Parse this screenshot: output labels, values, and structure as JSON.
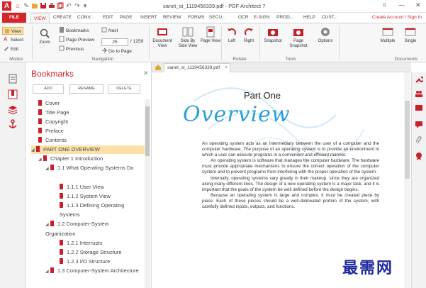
{
  "titlebar": {
    "app_logo": "A",
    "title": "sanet_st_1119456339.pdf - PDF Architect 7",
    "quick_access": [
      "home-icon",
      "pin-icon",
      "folder-icon",
      "save-icon",
      "print-icon",
      "copy-icon",
      "undo-icon",
      "redo-icon",
      "dropdown-icon"
    ],
    "window_controls": [
      "restore-icon",
      "minimize-icon",
      "close-icon"
    ]
  },
  "tabs": {
    "file": "FILE",
    "items": [
      "VIEW",
      "CREATE",
      "CONV...",
      "EDIT",
      "PAGE",
      "INSERT",
      "REVIEW",
      "FORMS",
      "SECU...",
      "OCR",
      "E-SIGN",
      "PROD...",
      "HELP",
      "CUST..."
    ],
    "active": "VIEW",
    "account_link": "Create Account / Sign In"
  },
  "ribbon": {
    "modes": {
      "view": "View",
      "select": "Select",
      "edit": "Edit",
      "group": "Modes"
    },
    "zoom": "Zoom",
    "navigation": {
      "bookmarks": "Bookmarks",
      "page_preview": "Page Preview",
      "previous": "Previous",
      "next": "Next",
      "current_page": "25",
      "total_pages": "/ 1259",
      "go_to_page": "Go to Page",
      "group": "Navigation"
    },
    "document_view": "Document View",
    "side_by_side": "Side By Side View",
    "page_view": "Page View",
    "left": "Left",
    "right": "Right",
    "rotate_group": "Rotate",
    "snapshot": "Snapshot",
    "page_snapshot": "Page Snapshot",
    "tools_group": "Tools",
    "options": "Options",
    "multiple": "Multiple",
    "single": "Single",
    "documents_group": "Documents"
  },
  "bookmarks": {
    "title": "Bookmarks",
    "add": "ADD",
    "rename": "RENAME",
    "delete": "DELETE",
    "items": [
      {
        "label": "Cover"
      },
      {
        "label": "Title Page"
      },
      {
        "label": "Copyright"
      },
      {
        "label": "Preface"
      },
      {
        "label": "Contents"
      },
      {
        "label": "PART ONE OVERVIEW"
      },
      {
        "label": "Chapter 1 Introduction"
      },
      {
        "label": "1.1 What Operating Systems Do"
      },
      {
        "label": "1.1.1 User View"
      },
      {
        "label": "1.1.2 System View"
      },
      {
        "label": "1.1.3 Defining Operating Systems"
      },
      {
        "label": "1.2 Computer-System Organization"
      },
      {
        "label": "1.2.1 Interrupts"
      },
      {
        "label": "1.2.2 Storage Structure"
      },
      {
        "label": "1.2.3 I/O Structure"
      },
      {
        "label": "1.3 Computer-System Architecture"
      }
    ],
    "selected": "PART ONE OVERVIEW"
  },
  "document": {
    "tab_name": "sanet_st_1119456339.pdf",
    "part_heading": "Part One",
    "section_heading": "Overview",
    "paragraphs": [
      "An operating system acts as an intermediary between the user of a computer and the computer hardware. The purpose of an operating system is to provide an environment in which a user can execute programs in a convenient and efficient manner.",
      "An operating system is software that manages the computer hardware. The hardware must provide appropriate mechanisms to ensure the correct operation of the computer system and to prevent programs from interfering with the proper operation of the system.",
      "Internally, operating systems vary greatly in their makeup, since they are organized along many different lines. The design of a new operating system is a major task, and it is important that the goals of the system be well defined before the design begins.",
      "Because an operating system is large and complex, it must be created piece by piece. Each of these pieces should be a well-delineated portion of the system, with carefully defined inputs, outputs, and functions."
    ]
  },
  "watermark": "最需网",
  "colors": {
    "accent": "#d5262a",
    "heading_blue": "#2a9fd8",
    "selection": "#fbe1a8"
  }
}
